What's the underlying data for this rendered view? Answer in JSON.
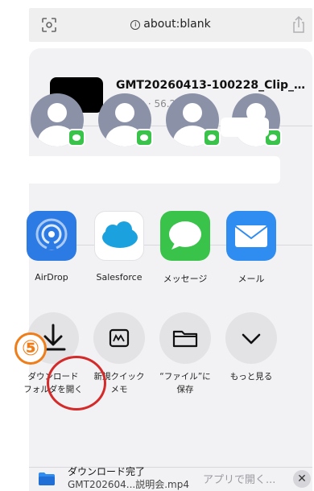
{
  "topbar": {
    "url": "about:blank",
    "info_glyph": "i",
    "icons": [
      "scan-icon",
      "share-icon"
    ]
  },
  "file": {
    "name": "GMT20260413-100228_Clip_…",
    "meta": "ビデオ · 56.2 MB"
  },
  "apps": [
    {
      "label": "AirDrop",
      "icon": "airdrop-icon"
    },
    {
      "label": "Salesforce",
      "icon": "salesforce-icon"
    },
    {
      "label": "メッセージ",
      "icon": "messages-icon"
    },
    {
      "label": "メール",
      "icon": "mail-icon"
    }
  ],
  "actions": [
    {
      "line1": "ダウンロード",
      "line2": "フォルダを開く",
      "icon": "download-icon"
    },
    {
      "line1": "新規クイック",
      "line2": "メモ",
      "icon": "quick-note-icon"
    },
    {
      "line1": "“ファイル”に",
      "line2": "保存",
      "icon": "folder-icon"
    },
    {
      "line1": "もっと見る",
      "line2": "",
      "icon": "chevron-down-icon"
    }
  ],
  "annotation": {
    "step": "⑤"
  },
  "download_bar": {
    "title": "ダウンロード完了",
    "filename": "GMT202604...説明会.mp4",
    "open_with": "アプリで開く...",
    "close": "✕"
  },
  "colors": {
    "accent_green": "#3ac34a",
    "airdrop_blue": "#2c7be5",
    "annotation_red": "#d42a2a",
    "annotation_orange": "#ef7e1a"
  }
}
